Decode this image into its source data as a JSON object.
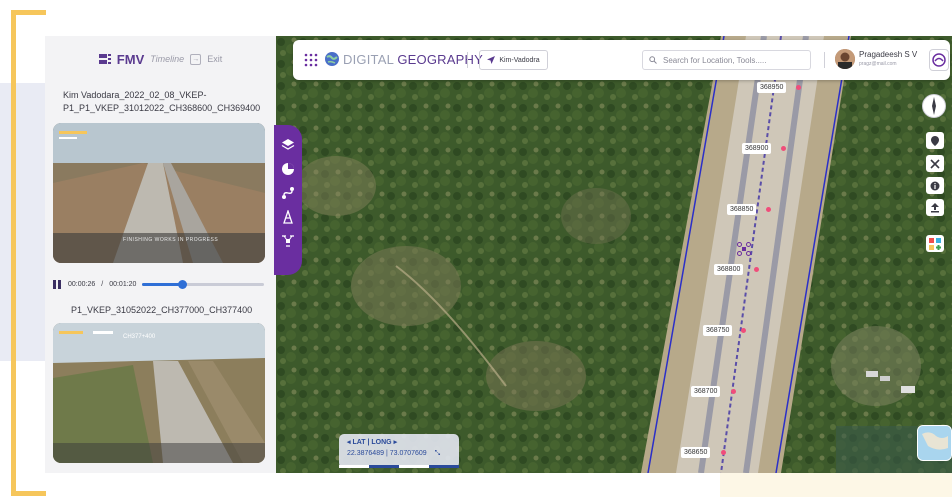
{
  "fmv_panel": {
    "title": "FMV",
    "timeline_label": "Timeline",
    "exit_label": "Exit",
    "videos": [
      {
        "title": "Kim Vadodara_2022_02_08_VKEP-P1_P1_VKEP_31012022_CH368600_CH369400",
        "overlay_caption": "FINISHING WORKS IN PROGRESS"
      },
      {
        "title": "P1_VKEP_31052022_CH377000_CH377400",
        "overlay_caption": "CH377+400"
      }
    ],
    "player": {
      "elapsed": "00:00:26",
      "separator": "/",
      "duration": "00:01:20",
      "progress": 0.325
    }
  },
  "header": {
    "brand_light": "DIGITAL",
    "brand_bold": "GEOGRAPHY",
    "location": "Kim-Vadodra",
    "search_placeholder": "Search for Location, Tools.....",
    "user_name": "Pragadeesh S V",
    "user_email": "pragz@mail.com"
  },
  "sidebar_tools": [
    "layers-icon",
    "analytics-icon",
    "route-icon",
    "tower-icon",
    "drone-icon"
  ],
  "map_tools": [
    "location-pin-icon",
    "tools-icon",
    "info-icon",
    "upload-icon",
    "widgets-icon"
  ],
  "chainages": [
    "368950",
    "368900",
    "368850",
    "368800",
    "368750",
    "368700",
    "368650"
  ],
  "coordinates": {
    "label": "LAT | LONG",
    "lat": "22.3876489",
    "separator": "|",
    "long": "73.0707609"
  },
  "colors": {
    "accent": "#6a2ea0",
    "frame": "#f6c65b",
    "progress": "#2f6fd6",
    "pin": "#f04d7a",
    "road_edge": "#2b2fc8"
  }
}
